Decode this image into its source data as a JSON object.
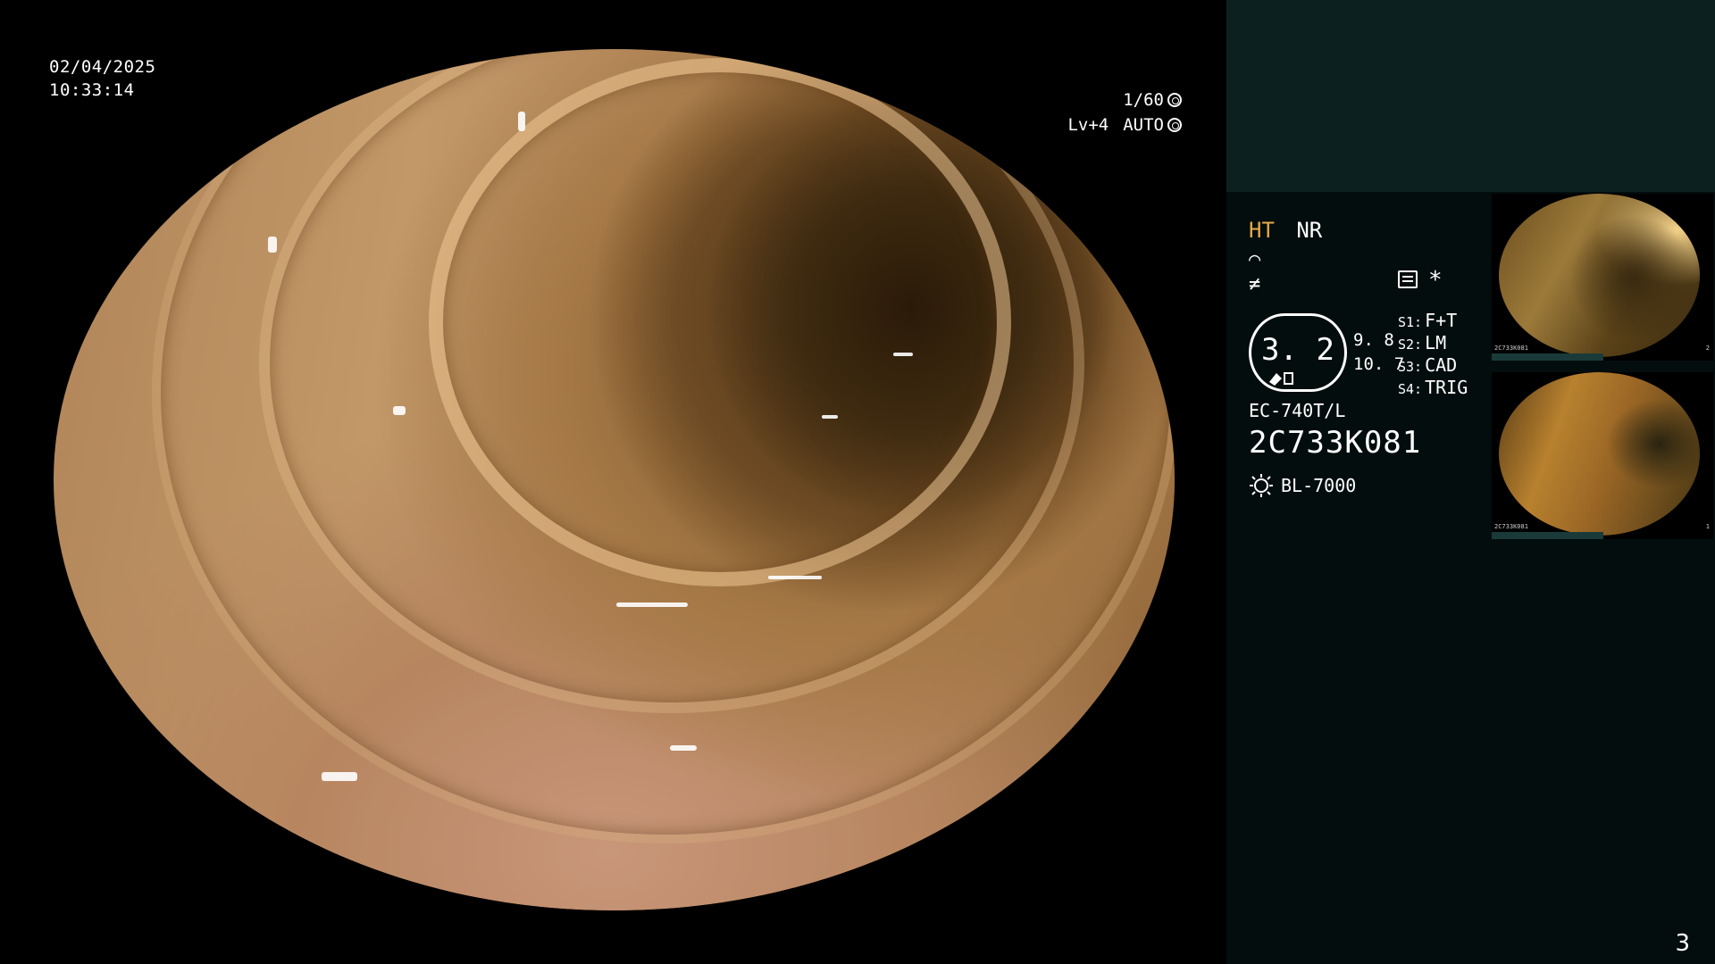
{
  "overlay": {
    "date": "02/04/2025",
    "time": "10:33:14",
    "shutter": "1/60",
    "shutter_icon": "shutter-icon",
    "level": "Lv+4",
    "iris": "AUTO",
    "iris_icon": "iris-icon"
  },
  "panel": {
    "mode_ht": "HT",
    "mode_nr": "NR",
    "symbol_1": "⌒",
    "symbol_2": "≠",
    "zoom_value": "3. 2",
    "zoom_sub_1": "9. 8",
    "zoom_sub_2": "10. 7",
    "scope_model": "EC-740T/L",
    "scope_serial": "2C733K081",
    "light_source": "BL-7000",
    "switches": [
      {
        "key": "S1:",
        "value": "F+T"
      },
      {
        "key": "S2:",
        "value": "LM"
      },
      {
        "key": "S3:",
        "value": "CAD"
      },
      {
        "key": "S4:",
        "value": "TRIG"
      }
    ],
    "asterisk": "*",
    "thumbnails": [
      {
        "id": "2C733K081",
        "index": "2"
      },
      {
        "id": "2C733K081",
        "index": "1"
      }
    ]
  },
  "page_number": "3",
  "colors": {
    "background": "#000000",
    "panel_bg": "#030d0d",
    "panel_header": "#0c2020",
    "ht_accent": "#e6a94a"
  }
}
